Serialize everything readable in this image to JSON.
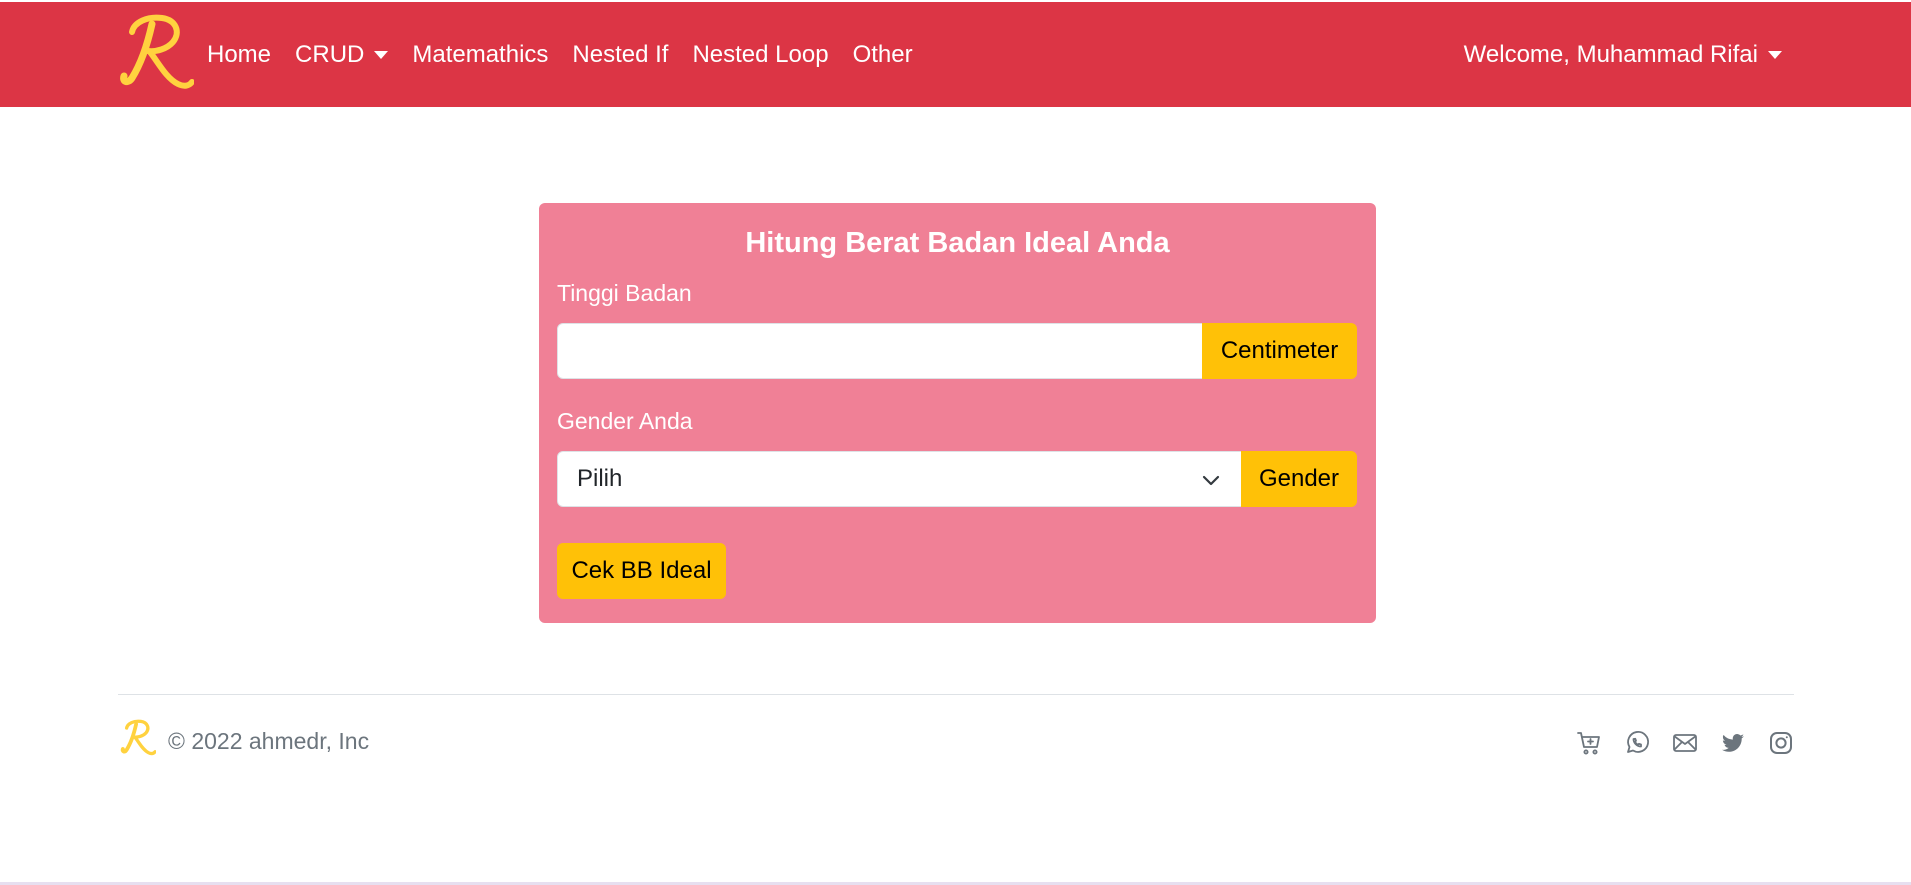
{
  "navbar": {
    "brand_letter": "R",
    "links": [
      {
        "label": "Home"
      },
      {
        "label": "CRUD"
      },
      {
        "label": "Matemathics"
      },
      {
        "label": "Nested If"
      },
      {
        "label": "Nested Loop"
      },
      {
        "label": "Other"
      }
    ],
    "user_menu_label": "Welcome, Muhammad Rifai"
  },
  "form": {
    "title": "Hitung Berat Badan Ideal Anda",
    "height_label": "Tinggi Badan",
    "height_value": "",
    "height_addon": "Centimeter",
    "gender_label": "Gender Anda",
    "gender_selected": "Pilih",
    "gender_addon": "Gender",
    "submit_label": "Cek BB Ideal"
  },
  "footer": {
    "copyright": "© 2022 ahmedr, Inc",
    "icons": [
      "cart-plus-icon",
      "whatsapp-icon",
      "envelope-icon",
      "twitter-icon",
      "instagram-icon"
    ]
  },
  "colors": {
    "navbar": "#dc3545",
    "card": "#f08096",
    "accent": "#ffc107",
    "logo": "#ffd23f",
    "muted": "#6c757d"
  }
}
